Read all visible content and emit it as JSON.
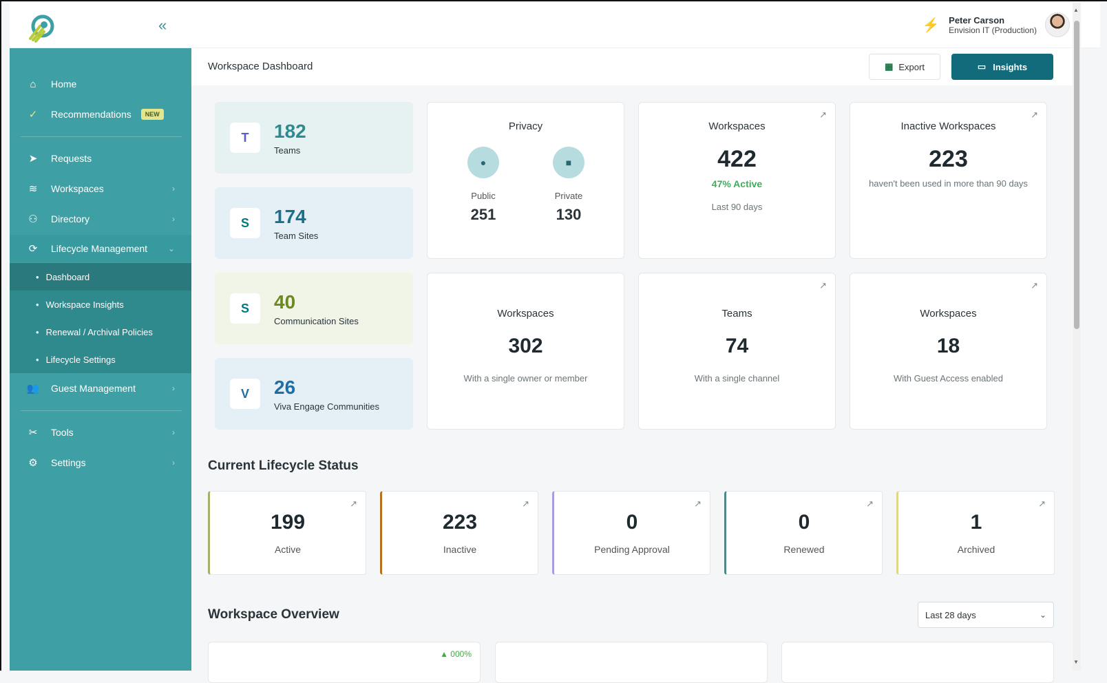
{
  "app": {
    "collapse_icon": "«"
  },
  "user": {
    "name": "Peter Carson",
    "org": "Envision IT (Production)"
  },
  "sidebar": {
    "items": [
      {
        "label": "Home",
        "icon": "⌂"
      },
      {
        "label": "Recommendations",
        "icon": "✓",
        "badge": "NEW"
      },
      {
        "label": "Requests",
        "icon": "➤"
      },
      {
        "label": "Workspaces",
        "icon": "≋"
      },
      {
        "label": "Directory",
        "icon": "⚇"
      },
      {
        "label": "Lifecycle Management",
        "icon": "⟳"
      },
      {
        "label": "Guest Management",
        "icon": "👥"
      },
      {
        "label": "Tools",
        "icon": "✂"
      },
      {
        "label": "Settings",
        "icon": "⚙"
      }
    ],
    "sub_items": [
      {
        "label": "Dashboard"
      },
      {
        "label": "Workspace Insights"
      },
      {
        "label": "Renewal / Archival Policies"
      },
      {
        "label": "Lifecycle Settings"
      }
    ],
    "chevron_right": "›",
    "chevron_down": "⌄"
  },
  "header": {
    "title": "Workspace Dashboard",
    "export_label": "Export",
    "insights_label": "Insights"
  },
  "stats": [
    {
      "value": "182",
      "label": "Teams",
      "color": "#2f8a8e",
      "bg": "#e6f1f2",
      "app": "T"
    },
    {
      "value": "174",
      "label": "Team Sites",
      "color": "#1c6f8a",
      "bg": "#e5f0f6",
      "app": "S"
    },
    {
      "value": "40",
      "label": "Communication Sites",
      "color": "#6b8a1e",
      "bg": "#f1f5e8",
      "app": "S"
    },
    {
      "value": "26",
      "label": "Viva Engage Communities",
      "color": "#1e6fa5",
      "bg": "#e5f0f6",
      "app": "V"
    }
  ],
  "privacy": {
    "title": "Privacy",
    "public_label": "Public",
    "public_value": "251",
    "private_label": "Private",
    "private_value": "130"
  },
  "workspaces_card": {
    "title": "Workspaces",
    "value": "422",
    "active": "47% Active",
    "period": "Last 90 days"
  },
  "inactive_card": {
    "title": "Inactive Workspaces",
    "value": "223",
    "note": "haven't been used in more than 90 days"
  },
  "single_owner": {
    "title": "Workspaces",
    "value": "302",
    "note": "With a single owner or member"
  },
  "single_channel": {
    "title": "Teams",
    "value": "74",
    "note": "With a single channel"
  },
  "guest_access": {
    "title": "Workspaces",
    "value": "18",
    "note": "With Guest Access enabled"
  },
  "lifecycle": {
    "title": "Current Lifecycle Status",
    "cards": [
      {
        "value": "199",
        "label": "Active",
        "color": "#a7ad6a"
      },
      {
        "value": "223",
        "label": "Inactive",
        "color": "#b8701e"
      },
      {
        "value": "0",
        "label": "Pending Approval",
        "color": "#a99be0"
      },
      {
        "value": "0",
        "label": "Renewed",
        "color": "#4d8a86"
      },
      {
        "value": "1",
        "label": "Archived",
        "color": "#e0d68a"
      }
    ]
  },
  "overview": {
    "title": "Workspace Overview",
    "range": "Last 28 days",
    "trend": "▲ 000%"
  }
}
